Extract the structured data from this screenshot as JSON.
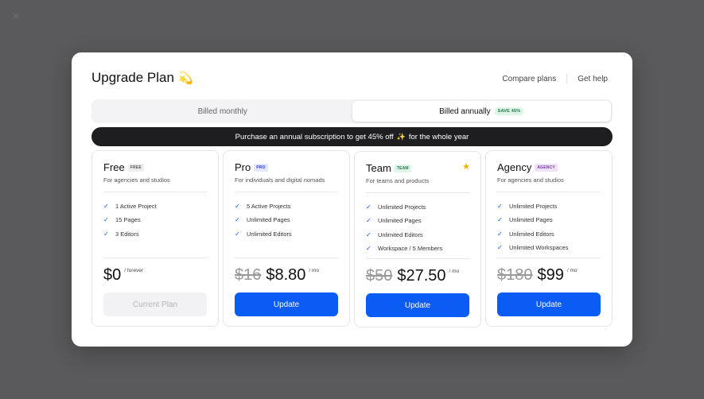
{
  "modal": {
    "title": "Upgrade Plan",
    "title_icon": "💫",
    "links": [
      "Compare plans",
      "Get help"
    ]
  },
  "billing": {
    "monthly_label": "Billed monthly",
    "annual_label": "Billed annually",
    "annual_badge": "SAVE 45%",
    "selected": "annual"
  },
  "promo": {
    "text_before": "Purchase an annual subscription to get 45% off",
    "sparkle": "✨",
    "text_after": "for the whole year"
  },
  "plans": [
    {
      "name": "Free",
      "badge": "FREE",
      "desc": "For agencies and studios",
      "features": [
        "1 Active Project",
        "15 Pages",
        "3 Editors"
      ],
      "old_price": "",
      "price": "$0",
      "period": "/ forever",
      "button": "Current Plan"
    },
    {
      "name": "Pro",
      "badge": "PRO",
      "desc": "For individuals and digital nomads",
      "features": [
        "5 Active Projects",
        "Unlimited Pages",
        "Unlimited Editors"
      ],
      "old_price": "$16",
      "price": "$8.80",
      "period": "/ mo",
      "button": "Update"
    },
    {
      "name": "Team",
      "badge": "TEAM",
      "desc": "For teams and products",
      "features": [
        "Unlimited Projects",
        "Unlimited Pages",
        "Unlimited Editors",
        "Workspace / 5 Members"
      ],
      "old_price": "$50",
      "price": "$27.50",
      "period": "/ mo",
      "button": "Update"
    },
    {
      "name": "Agency",
      "badge": "AGENCY",
      "desc": "For agencies and studios",
      "features": [
        "Unlimited Projects",
        "Unlimited Pages",
        "Unlimited Editors",
        "Unlimited Workspaces"
      ],
      "old_price": "$180",
      "price": "$99",
      "period": "/ mo",
      "button": "Update"
    }
  ],
  "colors": {
    "accent": "#0a5cf5",
    "promo_bg": "#1e1e20",
    "overlay": "#5a595b"
  },
  "icons": {
    "check": "check-icon",
    "star": "star-icon",
    "close": "close-icon"
  }
}
